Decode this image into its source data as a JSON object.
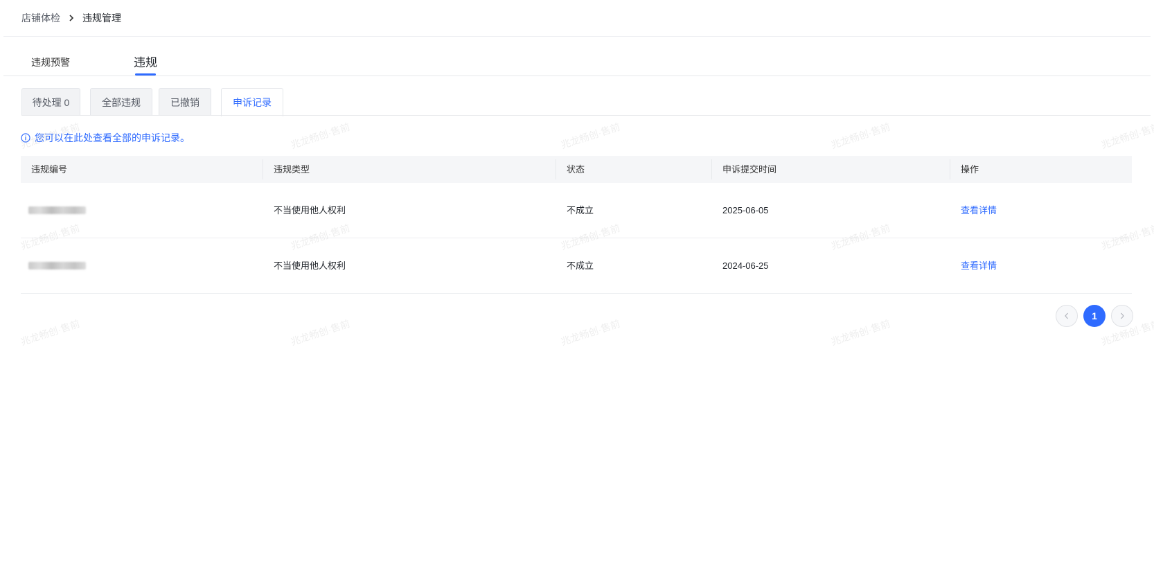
{
  "breadcrumb": {
    "parent": "店铺体检",
    "current": "违规管理"
  },
  "main_tabs": [
    {
      "label": "违规预警",
      "active": false
    },
    {
      "label": "违规",
      "active": true
    }
  ],
  "sub_tabs": [
    {
      "label": "待处理 0",
      "active": false
    },
    {
      "label": "全部违规",
      "active": false
    },
    {
      "label": "已撤销",
      "active": false
    },
    {
      "label": "申诉记录",
      "active": true
    }
  ],
  "notice": {
    "icon": "info-icon",
    "text": "您可以在此处查看全部的申诉记录。"
  },
  "table": {
    "columns": [
      "违规编号",
      "违规类型",
      "状态",
      "申诉提交时间",
      "操作"
    ],
    "rows": [
      {
        "type": "不当使用他人权利",
        "status": "不成立",
        "submitted": "2025-06-05",
        "action": "查看详情"
      },
      {
        "type": "不当使用他人权利",
        "status": "不成立",
        "submitted": "2024-06-25",
        "action": "查看详情"
      }
    ]
  },
  "pagination": {
    "current_page": "1",
    "prev_icon": "chevron-left-icon",
    "next_icon": "chevron-right-icon"
  },
  "watermark": "兆龙畅创·售前",
  "colors": {
    "accent": "#2f6bff",
    "header_bg": "#f5f6f8",
    "tab_bg": "#f2f3f5"
  }
}
